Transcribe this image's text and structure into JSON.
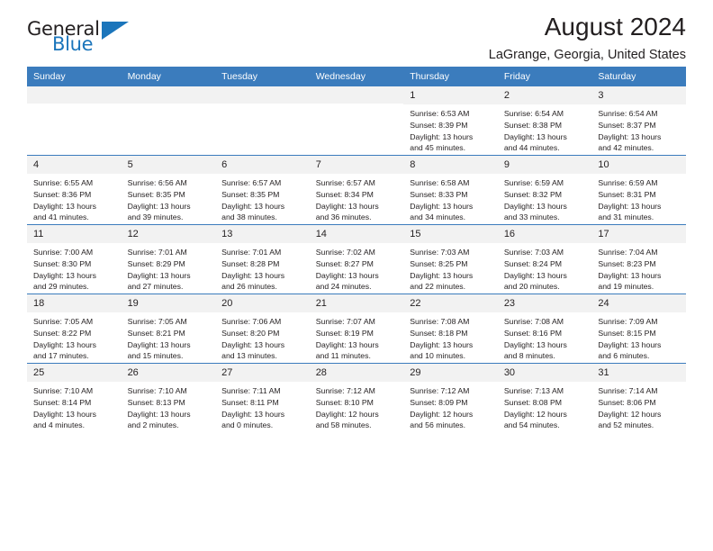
{
  "logo": {
    "word_top": "General",
    "word_bottom": "Blue",
    "triangle": "blue-triangle-icon",
    "accent_color": "#1b75bb"
  },
  "header": {
    "title": "August 2024",
    "subtitle": "LaGrange, Georgia, United States"
  },
  "theme": {
    "header_bg": "#3b7cbd",
    "daynum_bg": "#f2f2f2",
    "text": "#231f20"
  },
  "weekday_headers": [
    "Sunday",
    "Monday",
    "Tuesday",
    "Wednesday",
    "Thursday",
    "Friday",
    "Saturday"
  ],
  "weeks": [
    [
      {
        "day": "",
        "sunrise": "",
        "sunset": "",
        "daylight1": "",
        "daylight2": ""
      },
      {
        "day": "",
        "sunrise": "",
        "sunset": "",
        "daylight1": "",
        "daylight2": ""
      },
      {
        "day": "",
        "sunrise": "",
        "sunset": "",
        "daylight1": "",
        "daylight2": ""
      },
      {
        "day": "",
        "sunrise": "",
        "sunset": "",
        "daylight1": "",
        "daylight2": ""
      },
      {
        "day": "1",
        "sunrise": "Sunrise: 6:53 AM",
        "sunset": "Sunset: 8:39 PM",
        "daylight1": "Daylight: 13 hours",
        "daylight2": "and 45 minutes."
      },
      {
        "day": "2",
        "sunrise": "Sunrise: 6:54 AM",
        "sunset": "Sunset: 8:38 PM",
        "daylight1": "Daylight: 13 hours",
        "daylight2": "and 44 minutes."
      },
      {
        "day": "3",
        "sunrise": "Sunrise: 6:54 AM",
        "sunset": "Sunset: 8:37 PM",
        "daylight1": "Daylight: 13 hours",
        "daylight2": "and 42 minutes."
      }
    ],
    [
      {
        "day": "4",
        "sunrise": "Sunrise: 6:55 AM",
        "sunset": "Sunset: 8:36 PM",
        "daylight1": "Daylight: 13 hours",
        "daylight2": "and 41 minutes."
      },
      {
        "day": "5",
        "sunrise": "Sunrise: 6:56 AM",
        "sunset": "Sunset: 8:35 PM",
        "daylight1": "Daylight: 13 hours",
        "daylight2": "and 39 minutes."
      },
      {
        "day": "6",
        "sunrise": "Sunrise: 6:57 AM",
        "sunset": "Sunset: 8:35 PM",
        "daylight1": "Daylight: 13 hours",
        "daylight2": "and 38 minutes."
      },
      {
        "day": "7",
        "sunrise": "Sunrise: 6:57 AM",
        "sunset": "Sunset: 8:34 PM",
        "daylight1": "Daylight: 13 hours",
        "daylight2": "and 36 minutes."
      },
      {
        "day": "8",
        "sunrise": "Sunrise: 6:58 AM",
        "sunset": "Sunset: 8:33 PM",
        "daylight1": "Daylight: 13 hours",
        "daylight2": "and 34 minutes."
      },
      {
        "day": "9",
        "sunrise": "Sunrise: 6:59 AM",
        "sunset": "Sunset: 8:32 PM",
        "daylight1": "Daylight: 13 hours",
        "daylight2": "and 33 minutes."
      },
      {
        "day": "10",
        "sunrise": "Sunrise: 6:59 AM",
        "sunset": "Sunset: 8:31 PM",
        "daylight1": "Daylight: 13 hours",
        "daylight2": "and 31 minutes."
      }
    ],
    [
      {
        "day": "11",
        "sunrise": "Sunrise: 7:00 AM",
        "sunset": "Sunset: 8:30 PM",
        "daylight1": "Daylight: 13 hours",
        "daylight2": "and 29 minutes."
      },
      {
        "day": "12",
        "sunrise": "Sunrise: 7:01 AM",
        "sunset": "Sunset: 8:29 PM",
        "daylight1": "Daylight: 13 hours",
        "daylight2": "and 27 minutes."
      },
      {
        "day": "13",
        "sunrise": "Sunrise: 7:01 AM",
        "sunset": "Sunset: 8:28 PM",
        "daylight1": "Daylight: 13 hours",
        "daylight2": "and 26 minutes."
      },
      {
        "day": "14",
        "sunrise": "Sunrise: 7:02 AM",
        "sunset": "Sunset: 8:27 PM",
        "daylight1": "Daylight: 13 hours",
        "daylight2": "and 24 minutes."
      },
      {
        "day": "15",
        "sunrise": "Sunrise: 7:03 AM",
        "sunset": "Sunset: 8:25 PM",
        "daylight1": "Daylight: 13 hours",
        "daylight2": "and 22 minutes."
      },
      {
        "day": "16",
        "sunrise": "Sunrise: 7:03 AM",
        "sunset": "Sunset: 8:24 PM",
        "daylight1": "Daylight: 13 hours",
        "daylight2": "and 20 minutes."
      },
      {
        "day": "17",
        "sunrise": "Sunrise: 7:04 AM",
        "sunset": "Sunset: 8:23 PM",
        "daylight1": "Daylight: 13 hours",
        "daylight2": "and 19 minutes."
      }
    ],
    [
      {
        "day": "18",
        "sunrise": "Sunrise: 7:05 AM",
        "sunset": "Sunset: 8:22 PM",
        "daylight1": "Daylight: 13 hours",
        "daylight2": "and 17 minutes."
      },
      {
        "day": "19",
        "sunrise": "Sunrise: 7:05 AM",
        "sunset": "Sunset: 8:21 PM",
        "daylight1": "Daylight: 13 hours",
        "daylight2": "and 15 minutes."
      },
      {
        "day": "20",
        "sunrise": "Sunrise: 7:06 AM",
        "sunset": "Sunset: 8:20 PM",
        "daylight1": "Daylight: 13 hours",
        "daylight2": "and 13 minutes."
      },
      {
        "day": "21",
        "sunrise": "Sunrise: 7:07 AM",
        "sunset": "Sunset: 8:19 PM",
        "daylight1": "Daylight: 13 hours",
        "daylight2": "and 11 minutes."
      },
      {
        "day": "22",
        "sunrise": "Sunrise: 7:08 AM",
        "sunset": "Sunset: 8:18 PM",
        "daylight1": "Daylight: 13 hours",
        "daylight2": "and 10 minutes."
      },
      {
        "day": "23",
        "sunrise": "Sunrise: 7:08 AM",
        "sunset": "Sunset: 8:16 PM",
        "daylight1": "Daylight: 13 hours",
        "daylight2": "and 8 minutes."
      },
      {
        "day": "24",
        "sunrise": "Sunrise: 7:09 AM",
        "sunset": "Sunset: 8:15 PM",
        "daylight1": "Daylight: 13 hours",
        "daylight2": "and 6 minutes."
      }
    ],
    [
      {
        "day": "25",
        "sunrise": "Sunrise: 7:10 AM",
        "sunset": "Sunset: 8:14 PM",
        "daylight1": "Daylight: 13 hours",
        "daylight2": "and 4 minutes."
      },
      {
        "day": "26",
        "sunrise": "Sunrise: 7:10 AM",
        "sunset": "Sunset: 8:13 PM",
        "daylight1": "Daylight: 13 hours",
        "daylight2": "and 2 minutes."
      },
      {
        "day": "27",
        "sunrise": "Sunrise: 7:11 AM",
        "sunset": "Sunset: 8:11 PM",
        "daylight1": "Daylight: 13 hours",
        "daylight2": "and 0 minutes."
      },
      {
        "day": "28",
        "sunrise": "Sunrise: 7:12 AM",
        "sunset": "Sunset: 8:10 PM",
        "daylight1": "Daylight: 12 hours",
        "daylight2": "and 58 minutes."
      },
      {
        "day": "29",
        "sunrise": "Sunrise: 7:12 AM",
        "sunset": "Sunset: 8:09 PM",
        "daylight1": "Daylight: 12 hours",
        "daylight2": "and 56 minutes."
      },
      {
        "day": "30",
        "sunrise": "Sunrise: 7:13 AM",
        "sunset": "Sunset: 8:08 PM",
        "daylight1": "Daylight: 12 hours",
        "daylight2": "and 54 minutes."
      },
      {
        "day": "31",
        "sunrise": "Sunrise: 7:14 AM",
        "sunset": "Sunset: 8:06 PM",
        "daylight1": "Daylight: 12 hours",
        "daylight2": "and 52 minutes."
      }
    ]
  ]
}
